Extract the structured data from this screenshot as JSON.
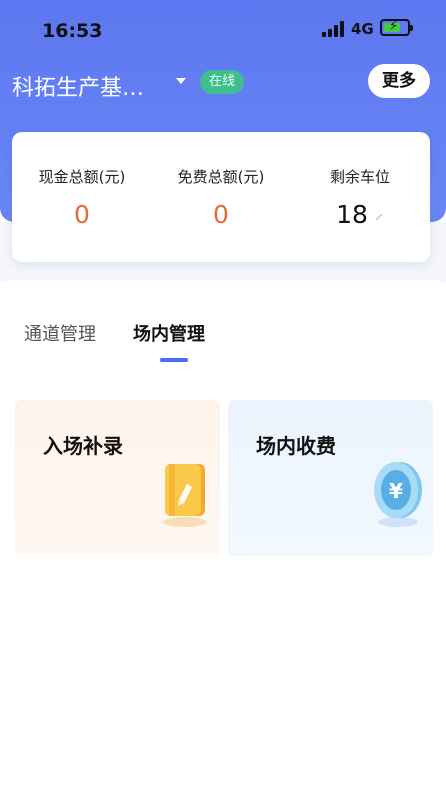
{
  "status_bar": {
    "time": "16:53",
    "network": "4G"
  },
  "header": {
    "site_name": "科拓生产基…",
    "online_badge": "在线",
    "more_label": "更多"
  },
  "stats": [
    {
      "label": "现金总额(元)",
      "value": "0"
    },
    {
      "label": "免费总额(元)",
      "value": "0"
    },
    {
      "label": "剩余车位",
      "value": "18"
    }
  ],
  "tabs": [
    {
      "label": "通道管理",
      "active": false
    },
    {
      "label": "场内管理",
      "active": true
    }
  ],
  "cards": [
    {
      "title": "入场补录",
      "icon": "notebook-edit-icon"
    },
    {
      "title": "场内收费",
      "icon": "yen-coin-icon"
    }
  ],
  "colors": {
    "header": "#5d78f0",
    "online": "#3fbf8f",
    "value_orange": "#e46a3c",
    "tab_indicator": "#4a6ef0"
  }
}
